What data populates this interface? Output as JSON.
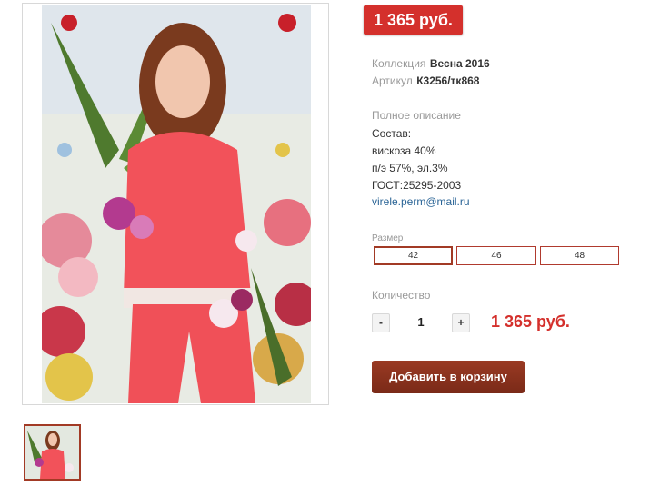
{
  "price_badge": "1 365 руб.",
  "info": {
    "collection_label": "Коллекция",
    "collection_value": "Весна 2016",
    "article_label": "Артикул",
    "article_value": "К3256/тк868"
  },
  "description": {
    "header": "Полное описание",
    "lines": [
      "Состав:",
      "вискоза 40%",
      "п/э 57%, эл.3%",
      "ГОСТ:25295-2003"
    ],
    "email": "virele.perm@mail.ru"
  },
  "size": {
    "label": "Размер",
    "options": [
      "42",
      "46",
      "48"
    ],
    "selected": "42"
  },
  "quantity": {
    "label": "Количество",
    "minus": "-",
    "value": "1",
    "plus": "+",
    "price": "1 365 руб."
  },
  "add_to_cart_label": "Добавить в корзину",
  "colors": {
    "price_red": "#d4302c",
    "button_brown": "#8a3220",
    "selected_border": "#a23a25",
    "link_blue": "#2a6496"
  }
}
